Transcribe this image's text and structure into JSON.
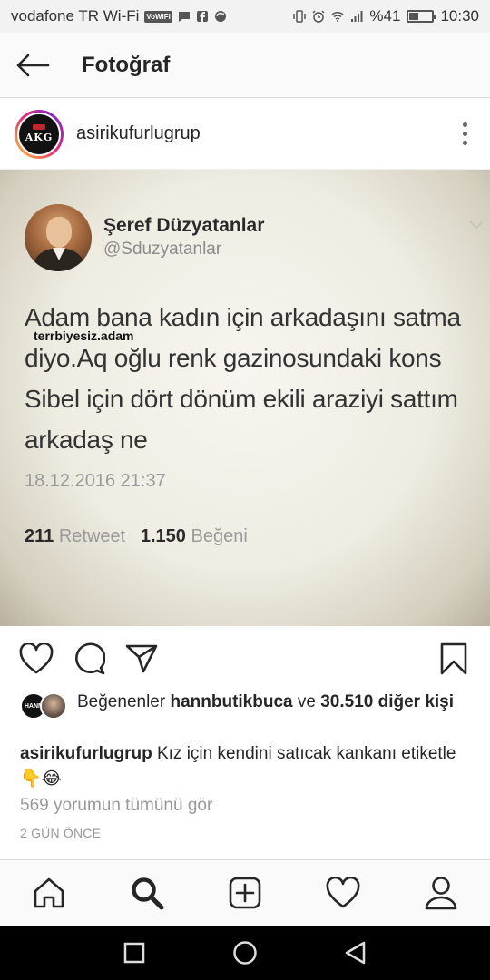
{
  "status_bar": {
    "carrier": "vodafone TR Wi-Fi",
    "volte": "VoWiFi",
    "battery_percent": "%41",
    "battery_level": 0.41,
    "time": "10:30"
  },
  "app_bar": {
    "title": "Fotoğraf"
  },
  "post": {
    "username": "asirikufurlugrup",
    "avatar_text": "AKG",
    "tweet": {
      "name": "Şeref Düzyatanlar",
      "handle": "@Sduzyatanlar",
      "text": "Adam bana kadın için arkadaşını satma diyo.Aq oğlu renk gazinosundaki kons Sibel için dört dönüm ekili araziyi sattım arkadaş ne",
      "watermark": "terrbiyesiz.adam",
      "date": "18.12.2016 21:37",
      "retweets": "211",
      "retweets_label": "Retweet",
      "likes": "1.150",
      "likes_label": "Beğeni"
    },
    "liker_avatar_text": "HANN",
    "likes_prefix": "Beğenenler ",
    "likes_user": "hannbutikbuca",
    "likes_middle": " ve ",
    "likes_others": "30.510 diğer kişi",
    "caption_user": "asirikufurlugrup",
    "caption_text": " Kız için kendini satıcak kankanı etiketle 👇😂",
    "view_comments": "569 yorumun tümünü gör",
    "time_ago": "2 GÜN ÖNCE"
  },
  "colors": {
    "accent": "#262626",
    "muted": "#999999",
    "photo_bg": "#efece2"
  },
  "icons": {
    "back": "arrow-left-icon",
    "more": "more-vertical-icon",
    "like": "heart-icon",
    "comment": "comment-icon",
    "share": "paper-plane-icon",
    "save": "bookmark-icon",
    "home": "home-icon",
    "search": "search-icon",
    "add": "add-post-icon",
    "activity": "heart-icon",
    "profile": "profile-icon"
  }
}
